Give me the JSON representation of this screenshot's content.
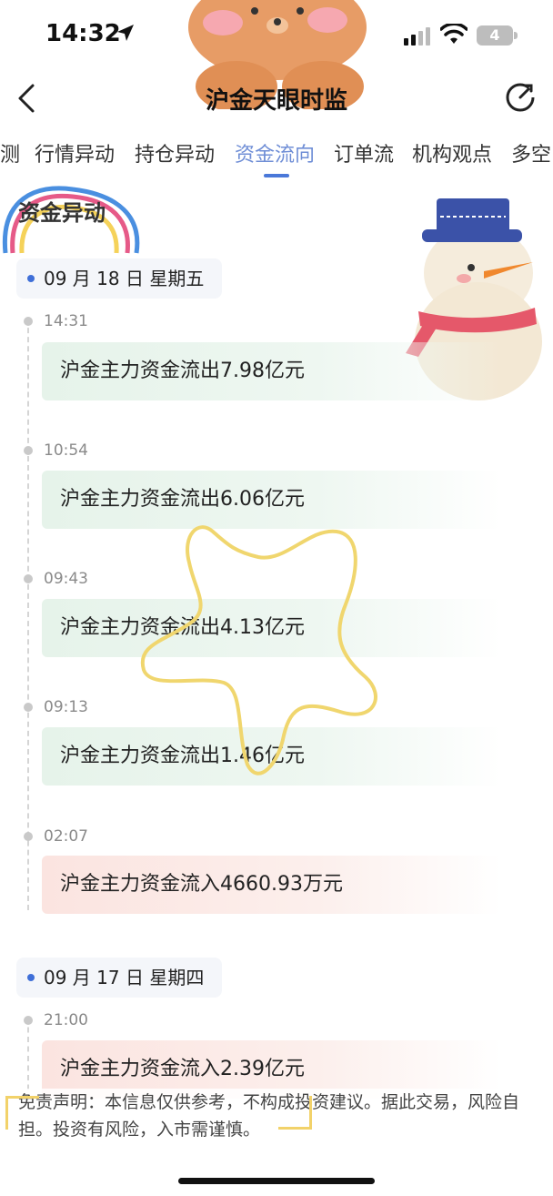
{
  "status_bar": {
    "time": "14:32",
    "battery": "4"
  },
  "nav": {
    "title": "沪金天眼时监"
  },
  "tabs": [
    {
      "label": "测",
      "active": false
    },
    {
      "label": "行情异动",
      "active": false
    },
    {
      "label": "持仓异动",
      "active": false
    },
    {
      "label": "资金流向",
      "active": true
    },
    {
      "label": "订单流",
      "active": false
    },
    {
      "label": "机构观点",
      "active": false
    },
    {
      "label": "多空",
      "active": false
    }
  ],
  "section_title": "资金异动",
  "groups": [
    {
      "date": "09 月 18 日 星期五",
      "entries": [
        {
          "time": "14:31",
          "text": "沪金主力资金流出7.98亿元",
          "direction": "out"
        },
        {
          "time": "10:54",
          "text": "沪金主力资金流出6.06亿元",
          "direction": "out"
        },
        {
          "time": "09:43",
          "text": "沪金主力资金流出4.13亿元",
          "direction": "out"
        },
        {
          "time": "09:13",
          "text": "沪金主力资金流出1.46亿元",
          "direction": "out"
        },
        {
          "time": "02:07",
          "text": "沪金主力资金流入4660.93万元",
          "direction": "in"
        }
      ]
    },
    {
      "date": "09 月 17 日 星期四",
      "entries": [
        {
          "time": "21:00",
          "text": "沪金主力资金流入2.39亿元",
          "direction": "in"
        }
      ]
    }
  ],
  "disclaimer": "免责声明：本信息仅供参考，不构成投资建议。据此交易，风险自担。投资有风险，入市需谨慎。",
  "colors": {
    "accent": "#4a78d9",
    "outflow_bg": "#e6f3ea",
    "inflow_bg": "#fbe4e0",
    "sticker_yellow": "#f2d26a"
  }
}
